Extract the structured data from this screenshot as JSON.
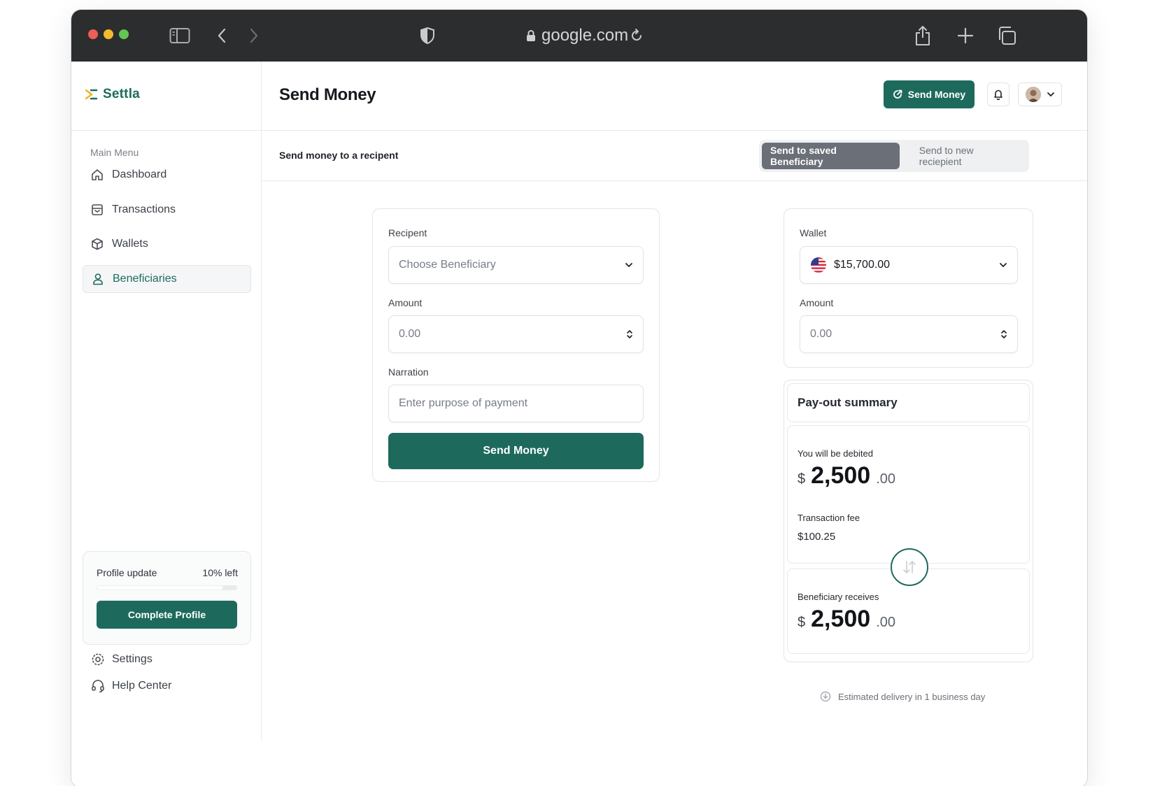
{
  "browser": {
    "url": "google.com"
  },
  "brand": {
    "name": "Settla",
    "accent": "#1d6a5d"
  },
  "sidebar": {
    "menu_title": "Main Menu",
    "items": [
      {
        "label": "Dashboard",
        "icon": "home-icon"
      },
      {
        "label": "Transactions",
        "icon": "inbox-icon"
      },
      {
        "label": "Wallets",
        "icon": "cube-icon"
      },
      {
        "label": "Beneficiaries",
        "icon": "user-icon",
        "active": true
      }
    ],
    "profile_card": {
      "title": "Profile update",
      "remaining": "10% left",
      "progress": 0.9,
      "button": "Complete Profile"
    },
    "bottom": [
      {
        "label": "Settings",
        "icon": "gear-icon"
      },
      {
        "label": "Help Center",
        "icon": "headset-icon"
      }
    ]
  },
  "header": {
    "title": "Send Money",
    "send_button": "Send Money"
  },
  "subheader": {
    "subtitle": "Send money to a recipent",
    "tabs": [
      {
        "label": "Send to saved Beneficiary",
        "active": true
      },
      {
        "label": "Send to new reciepient",
        "active": false
      }
    ]
  },
  "form": {
    "recipient_label": "Recipent",
    "recipient_placeholder": "Choose Beneficiary",
    "amount_label": "Amount",
    "amount_value": "0.00",
    "narration_label": "Narration",
    "narration_placeholder": "Enter purpose of payment",
    "submit": "Send Money"
  },
  "wallet": {
    "label": "Wallet",
    "balance": "$15,700.00",
    "amount_label": "Amount",
    "amount_value": "0.00"
  },
  "summary": {
    "title": "Pay-out summary",
    "debited_label": "You will be debited",
    "debited_currency": "$",
    "debited_whole": "2,500",
    "debited_decimal": ".00",
    "fee_label": "Transaction fee",
    "fee_value": "$100.25",
    "receives_label": "Beneficiary receives",
    "receives_currency": "$",
    "receives_whole": "2,500",
    "receives_decimal": ".00",
    "eta": "Estimated delivery in 1 business day"
  }
}
